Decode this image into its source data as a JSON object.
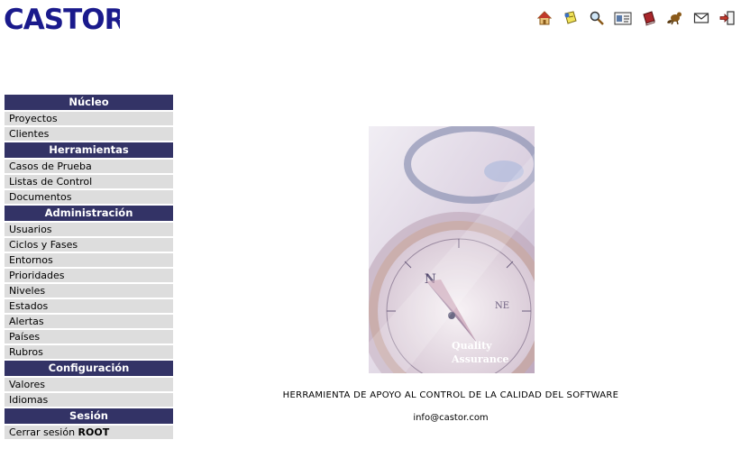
{
  "logo": {
    "text": "CASTOR"
  },
  "toolbar": {
    "icons": [
      "home-icon",
      "notes-icon",
      "search-icon",
      "contact-card-icon",
      "book-icon",
      "beaver-icon",
      "mail-icon",
      "logout-icon"
    ]
  },
  "sidebar": {
    "nucleo": {
      "title": "Núcleo",
      "items": [
        "Proyectos",
        "Clientes"
      ]
    },
    "herramientas": {
      "title": "Herramientas",
      "items": [
        "Casos de Prueba",
        "Listas de Control",
        "Documentos"
      ]
    },
    "administracion": {
      "title": "Administración",
      "items": [
        "Usuarios",
        "Ciclos y Fases",
        "Entornos",
        "Prioridades",
        "Niveles",
        "Estados",
        "Alertas",
        "Países",
        "Rubros"
      ]
    },
    "configuracion": {
      "title": "Configuración",
      "items": [
        "Valores",
        "Idiomas"
      ]
    },
    "sesion": {
      "title": "Sesión",
      "logout_prefix": "Cerrar sesión",
      "logout_user": "ROOT"
    }
  },
  "main": {
    "image_caption_line1": "Quality",
    "image_caption_line2": "Assurance",
    "tagline": "HERRAMIENTA DE APOYO AL CONTROL DE LA CALIDAD DEL SOFTWARE",
    "email": "info@castor.com"
  },
  "colors": {
    "header_bg": "#333366",
    "item_bg": "#dddddd",
    "logo_blue": "#1a1a8c"
  }
}
